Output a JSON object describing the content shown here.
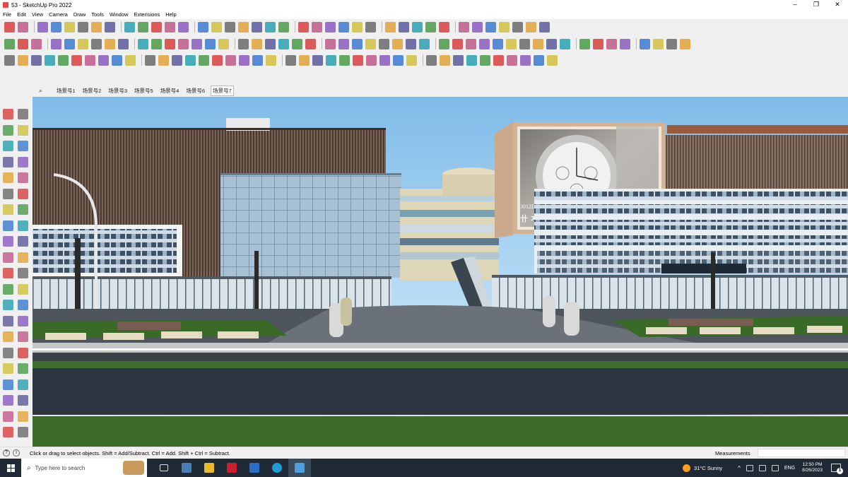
{
  "window": {
    "title": "53 - SketchUp Pro 2022",
    "minimize": "–",
    "maximize": "❐",
    "close": "✕"
  },
  "menu": [
    "File",
    "Edit",
    "View",
    "Camera",
    "Draw",
    "Tools",
    "Window",
    "Extensions",
    "Help"
  ],
  "scenes": {
    "tabs": [
      "场景号1",
      "场景号2",
      "场景号3",
      "场景号5",
      "场景号4",
      "场景号6",
      "场景号7"
    ],
    "active_index": 6
  },
  "viewport": {
    "billboard_text": "3012D",
    "billboard_logo": "卄 ㅈtt"
  },
  "statusbar": {
    "hint": "Click or drag to select objects. Shift = Add/Subtract. Ctrl = Add. Shift + Ctrl = Subtract.",
    "measurements_label": "Measurements",
    "measurements_value": ""
  },
  "taskbar": {
    "search_placeholder": "Type here to search",
    "weather": "31°C  Sunny",
    "language": "ENG",
    "time": "12:50 PM",
    "date": "8/26/2023",
    "notification_count": "1"
  },
  "colors": {
    "sky": "#8fc7ef",
    "road": "#2e3540",
    "grass": "#3e6b2a",
    "facade_slats": "#6f5648",
    "glass": "#a9c3d8",
    "taskbar": "#1f2a36"
  }
}
